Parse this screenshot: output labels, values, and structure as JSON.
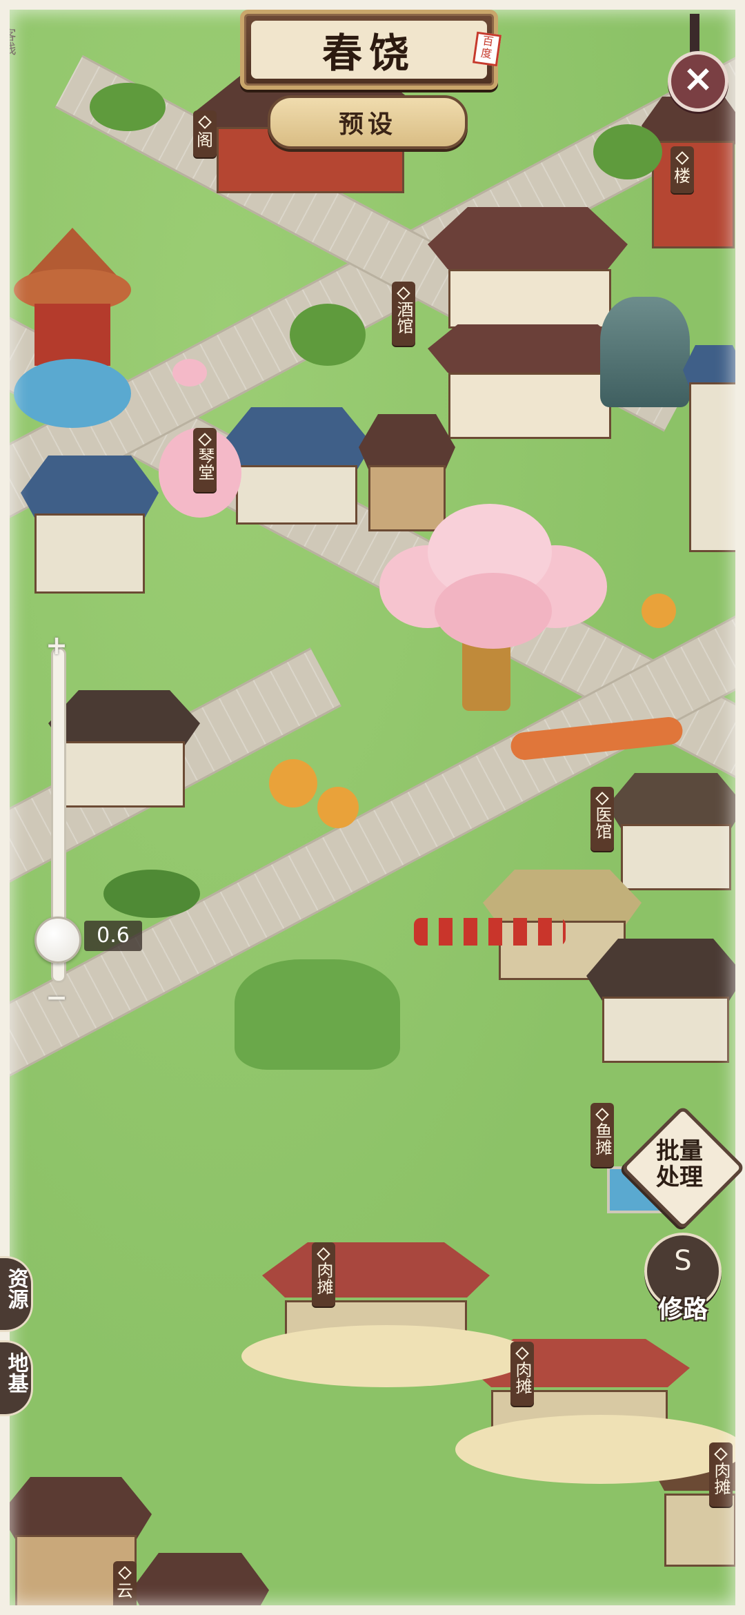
{
  "header": {
    "title": "春饶",
    "seal_text": "百度",
    "preset_label": "预设",
    "close_symbol": "×"
  },
  "zoom": {
    "plus_symbol": "+",
    "minus_symbol": "−",
    "value": "0.6",
    "level": 0.08
  },
  "actions": {
    "batch_label_top": "批量",
    "batch_label_bottom": "处理",
    "repair_road_label": "修路"
  },
  "left_tabs": [
    {
      "label": "资源"
    },
    {
      "label": "地基"
    }
  ],
  "map_labels": [
    {
      "text": "阁"
    },
    {
      "text": "楼"
    },
    {
      "text": "酒馆"
    },
    {
      "text": "琴堂"
    },
    {
      "text": "医馆"
    },
    {
      "text": "鱼摊"
    },
    {
      "text": "肉摊"
    },
    {
      "text": "肉摊"
    },
    {
      "text": "肉摊"
    },
    {
      "text": "云"
    }
  ],
  "corner_labels": {
    "top_left": "客栈"
  },
  "colors": {
    "grass": "#8cc267",
    "road": "#cfc8b8",
    "plaque": "#5a3a2a",
    "cherry_blossom": "#f4b9c8"
  }
}
